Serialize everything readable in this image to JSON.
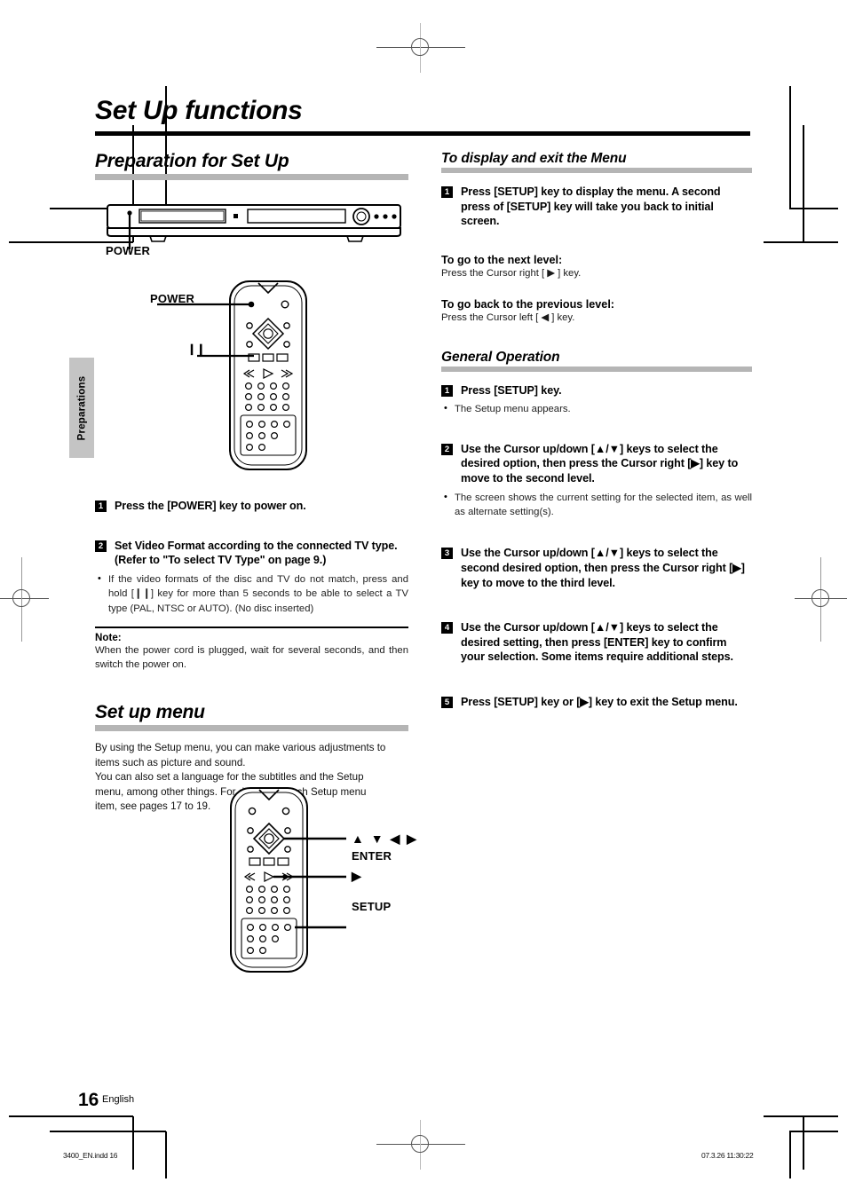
{
  "document": {
    "title": "Set Up functions",
    "page_number": "16",
    "language": "English",
    "side_tab": "Preparations",
    "imprint_file": "3400_EN.indd   16",
    "imprint_timestamp": "07.3.26   11:30:22"
  },
  "left_column": {
    "section1": {
      "heading": "Preparation for Set Up",
      "figure_labels": {
        "unit_power": "POWER",
        "remote_power": "POWER",
        "remote_pause": "❙❙"
      },
      "steps": [
        {
          "number": "1",
          "text": "Press the [POWER] key to power on."
        },
        {
          "number": "2",
          "text": "Set Video Format according to the connected TV type. (Refer to \"To select TV Type\" on page 9.)",
          "bullets": [
            "If the video formats of the disc and TV do not match, press and hold [❙❙] key for more than 5 seconds to be able to select a TV type (PAL, NTSC or AUTO). (No disc inserted)"
          ]
        }
      ],
      "note": {
        "label": "Note:",
        "body": "When the power cord is plugged, wait for several seconds, and then switch the power on."
      }
    },
    "section2": {
      "heading": "Set up menu",
      "paragraph_lines": [
        "By using the Setup menu, you can make various adjustments to",
        "items such as picture and sound.",
        "You can also set a language for the subtitles and the Setup",
        "menu, among other things. For details on each Setup menu",
        "item, see pages 17 to 19."
      ],
      "figure_labels": {
        "cursor_keys": "▲  ▼  ◀  ▶",
        "enter": "ENTER",
        "enter_arrow": "▶",
        "setup": "SETUP"
      }
    }
  },
  "right_column": {
    "section1": {
      "heading": "To display and exit the Menu",
      "steps": [
        {
          "number": "1",
          "text": "Press [SETUP] key to display the menu. A second press of [SETUP] key will take you back to initial screen."
        }
      ],
      "subsections": [
        {
          "heading": "To go to the next level:",
          "text": "Press the Cursor right [ ▶ ] key."
        },
        {
          "heading": "To go back to the previous level:",
          "text": "Press the Cursor left [ ◀ ] key."
        }
      ]
    },
    "section2": {
      "heading": "General Operation",
      "steps": [
        {
          "number": "1",
          "text": "Press [SETUP] key.",
          "bullets": [
            "The Setup menu appears."
          ]
        },
        {
          "number": "2",
          "text": "Use the Cursor up/down [▲/▼] keys to select the desired option, then press the Cursor right [▶] key to move to the second level.",
          "bullets": [
            "The screen shows the current setting for the selected item, as well as alternate setting(s)."
          ]
        },
        {
          "number": "3",
          "text": "Use the Cursor up/down [▲/▼] keys to select the second desired option, then press the Cursor right [▶] key to move to the third level.",
          "bullets": []
        },
        {
          "number": "4",
          "text": "Use the Cursor up/down [▲/▼] keys to select the desired setting, then press [ENTER] key to confirm your selection. Some items require additional steps.",
          "bullets": []
        },
        {
          "number": "5",
          "text": "Press [SETUP] key or [▶] key to exit the Setup menu.",
          "bullets": []
        }
      ]
    }
  }
}
